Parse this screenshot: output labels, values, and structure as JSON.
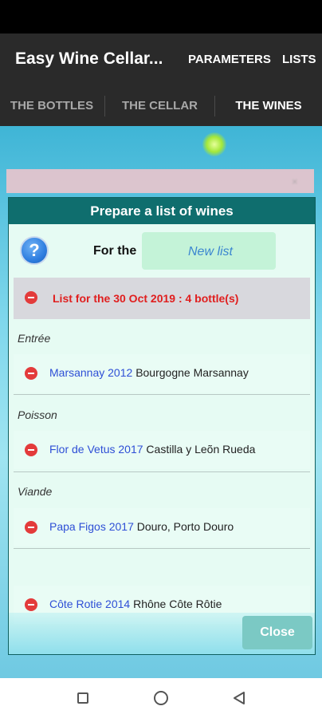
{
  "app": {
    "title": "Easy Wine Cellar..."
  },
  "menu": {
    "parameters": "PARAMETERS",
    "lists": "LISTS"
  },
  "tabs": [
    {
      "label": "THE BOTTLES",
      "active": false
    },
    {
      "label": "THE CELLAR",
      "active": false
    },
    {
      "label": "THE WINES",
      "active": true
    }
  ],
  "dialog": {
    "title": "Prepare a list of wines",
    "help_icon": "?",
    "for_label": "For the",
    "list_name_placeholder": "New list",
    "list_header": "List for the 30 Oct 2019 : 4 bottle(s)",
    "sections": [
      {
        "label": "Entrée",
        "wine": {
          "name": "Marsannay 2012",
          "region": "Bourgogne Marsannay"
        }
      },
      {
        "label": "Poisson",
        "wine": {
          "name": "Flor de Vetus 2017",
          "region": "Castilla y Leõn Rueda"
        }
      },
      {
        "label": "Viande",
        "wine": {
          "name": "Papa Figos 2017",
          "region": "Douro, Porto Douro"
        }
      },
      {
        "label": "",
        "wine": {
          "name": "Côte Rotie 2014",
          "region": "Rhône Côte Rôtie"
        }
      }
    ],
    "close_label": "Close"
  },
  "colors": {
    "header_teal": "#0f6e6e",
    "dialog_bg": "#e6fbf3",
    "wine_name_blue": "#2e4fd6",
    "list_header_red": "#e01e1e",
    "minus_red": "#e33b3b"
  },
  "icons": {
    "help": "question-circle-icon",
    "remove": "minus-circle-icon",
    "nav_recent": "square-icon",
    "nav_home": "circle-icon",
    "nav_back": "triangle-back-icon"
  }
}
